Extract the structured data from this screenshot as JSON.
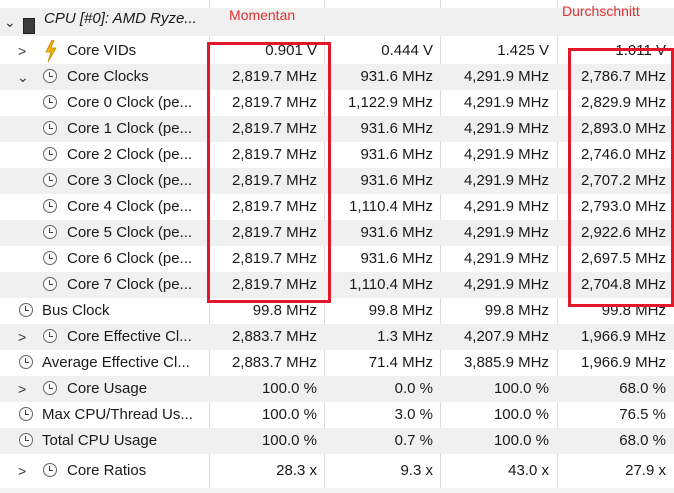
{
  "header": {
    "title": "CPU [#0]: AMD Ryze..."
  },
  "annotations": {
    "momentan": "Momentan",
    "durchschnitt": "Durchschnitt"
  },
  "rows": [
    {
      "label": "Core VIDs",
      "v1": "0.901 V",
      "v2": "0.444 V",
      "v3": "1.425 V",
      "v4": "1.011 V"
    },
    {
      "label": "Core Clocks",
      "v1": "2,819.7 MHz",
      "v2": "931.6 MHz",
      "v3": "4,291.9 MHz",
      "v4": "2,786.7 MHz"
    },
    {
      "label": "Core 0 Clock (pe...",
      "v1": "2,819.7 MHz",
      "v2": "1,122.9 MHz",
      "v3": "4,291.9 MHz",
      "v4": "2,829.9 MHz"
    },
    {
      "label": "Core 1 Clock (pe...",
      "v1": "2,819.7 MHz",
      "v2": "931.6 MHz",
      "v3": "4,291.9 MHz",
      "v4": "2,893.0 MHz"
    },
    {
      "label": "Core 2 Clock (pe...",
      "v1": "2,819.7 MHz",
      "v2": "931.6 MHz",
      "v3": "4,291.9 MHz",
      "v4": "2,746.0 MHz"
    },
    {
      "label": "Core 3 Clock (pe...",
      "v1": "2,819.7 MHz",
      "v2": "931.6 MHz",
      "v3": "4,291.9 MHz",
      "v4": "2,707.2 MHz"
    },
    {
      "label": "Core 4 Clock (pe...",
      "v1": "2,819.7 MHz",
      "v2": "1,110.4 MHz",
      "v3": "4,291.9 MHz",
      "v4": "2,793.0 MHz"
    },
    {
      "label": "Core 5 Clock (pe...",
      "v1": "2,819.7 MHz",
      "v2": "931.6 MHz",
      "v3": "4,291.9 MHz",
      "v4": "2,922.6 MHz"
    },
    {
      "label": "Core 6 Clock (pe...",
      "v1": "2,819.7 MHz",
      "v2": "931.6 MHz",
      "v3": "4,291.9 MHz",
      "v4": "2,697.5 MHz"
    },
    {
      "label": "Core 7 Clock (pe...",
      "v1": "2,819.7 MHz",
      "v2": "1,110.4 MHz",
      "v3": "4,291.9 MHz",
      "v4": "2,704.8 MHz"
    },
    {
      "label": "Bus Clock",
      "v1": "99.8 MHz",
      "v2": "99.8 MHz",
      "v3": "99.8 MHz",
      "v4": "99.8 MHz"
    },
    {
      "label": "Core Effective Cl...",
      "v1": "2,883.7 MHz",
      "v2": "1.3 MHz",
      "v3": "4,207.9 MHz",
      "v4": "1,966.9 MHz"
    },
    {
      "label": "Average Effective Cl...",
      "v1": "2,883.7 MHz",
      "v2": "71.4 MHz",
      "v3": "3,885.9 MHz",
      "v4": "1,966.9 MHz"
    },
    {
      "label": "Core Usage",
      "v1": "100.0 %",
      "v2": "0.0 %",
      "v3": "100.0 %",
      "v4": "68.0 %"
    },
    {
      "label": "Max CPU/Thread Us...",
      "v1": "100.0 %",
      "v2": "3.0 %",
      "v3": "100.0 %",
      "v4": "76.5 %"
    },
    {
      "label": "Total CPU Usage",
      "v1": "100.0 %",
      "v2": "0.7 %",
      "v3": "100.0 %",
      "v4": "68.0 %"
    },
    {
      "label": "Core Ratios",
      "v1": "28.3 x",
      "v2": "9.3 x",
      "v3": "43.0 x",
      "v4": "27.9 x"
    }
  ]
}
